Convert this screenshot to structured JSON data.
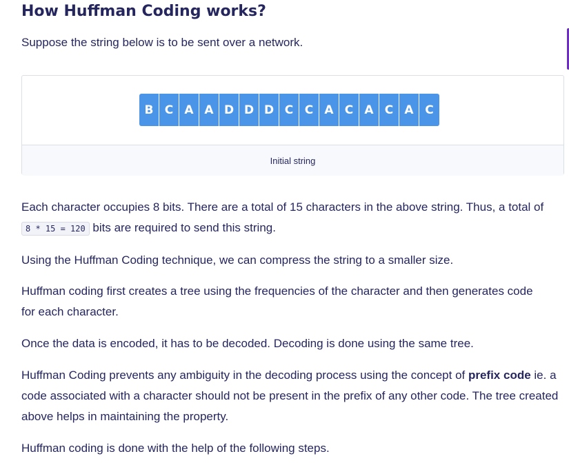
{
  "heading": "How Huffman Coding works?",
  "intro": "Suppose the string below is to be sent over a network.",
  "figure": {
    "characters": [
      "B",
      "C",
      "A",
      "A",
      "D",
      "D",
      "D",
      "C",
      "C",
      "A",
      "C",
      "A",
      "C",
      "A",
      "C"
    ],
    "caption": "Initial string"
  },
  "colors": {
    "char_box": "#4a95e8",
    "text": "#25265e",
    "accent_tab": "#6b2fb9"
  },
  "paragraphs": {
    "p1_before": "Each character occupies 8 bits. There are a total of 15 characters in the above string. Thus, a total of ",
    "p1_code": "8 * 15 = 120",
    "p1_after": " bits are required to send this string.",
    "p2": "Using the Huffman Coding technique, we can compress the string to a smaller size.",
    "p3": "Huffman coding first creates a tree using the frequencies of the character and then generates code for each character.",
    "p4": "Once the data is encoded, it has to be decoded. Decoding is done using the same tree.",
    "p5_before": "Huffman Coding prevents any ambiguity in the decoding process using the concept of ",
    "p5_bold": "prefix code",
    "p5_after": " ie. a code associated with a character should not be present in the prefix of any other code. The tree created above helps in maintaining the property.",
    "p6": "Huffman coding is done with the help of the following steps."
  }
}
